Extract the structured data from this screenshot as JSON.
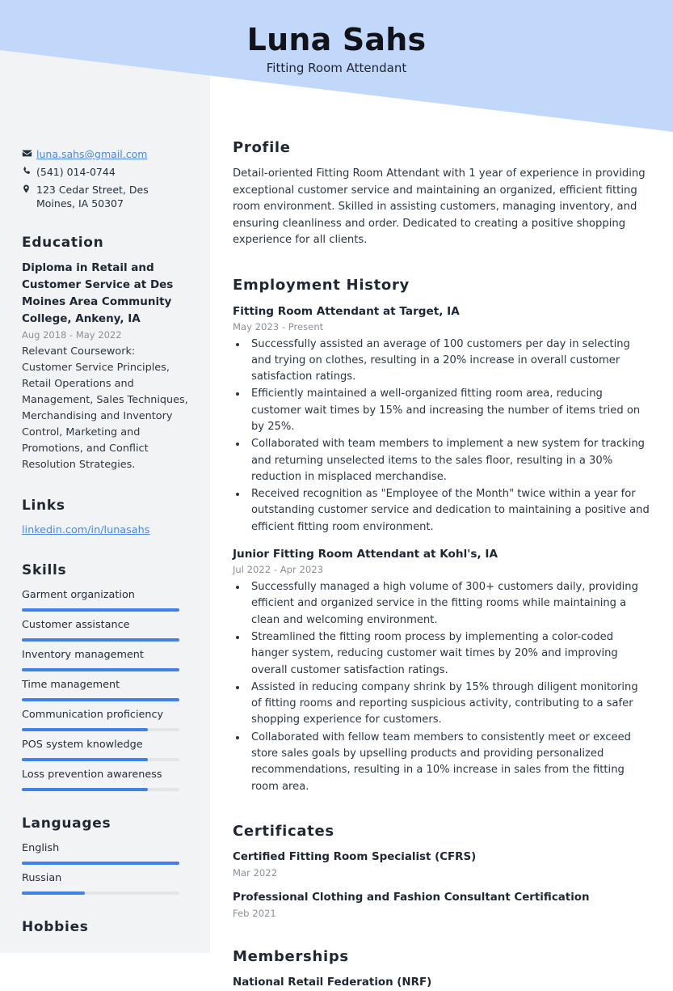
{
  "header": {
    "name": "Luna Sahs",
    "job_title": "Fitting Room Attendant",
    "banner_color": "#c2d8fb"
  },
  "theme": {
    "accent": "#4180e8",
    "sidebar_bg": "#f2f3f4",
    "link_color": "#4a87e8",
    "heading_color": "#1f2733",
    "muted_text": "#8a9099"
  },
  "sidebar": {
    "contact": [
      {
        "icon": "envelope-icon",
        "value": "luna.sahs@gmail.com",
        "is_link": true
      },
      {
        "icon": "phone-icon",
        "value": "(541) 014-0744",
        "is_link": false
      },
      {
        "icon": "location-pin-icon",
        "value": "123 Cedar Street, Des Moines, IA 50307",
        "is_link": false
      }
    ],
    "education": {
      "heading": "Education",
      "entries": [
        {
          "title": "Diploma in Retail and Customer Service at Des Moines Area Community College, Ankeny, IA",
          "date": "Aug 2018 - May 2022",
          "description": "Relevant Coursework: Customer Service Principles, Retail Operations and Management, Sales Techniques, Merchandising and Inventory Control, Marketing and Promotions, and Conflict Resolution Strategies."
        }
      ]
    },
    "links": {
      "heading": "Links",
      "items": [
        {
          "label": "linkedin.com/in/lunasahs"
        }
      ]
    },
    "skills": {
      "heading": "Skills",
      "items": [
        {
          "label": "Garment organization",
          "level": 100
        },
        {
          "label": "Customer assistance",
          "level": 100
        },
        {
          "label": "Inventory management",
          "level": 100
        },
        {
          "label": "Time management",
          "level": 100
        },
        {
          "label": "Communication proficiency",
          "level": 80
        },
        {
          "label": "POS system knowledge",
          "level": 80
        },
        {
          "label": "Loss prevention awareness",
          "level": 80
        }
      ]
    },
    "languages": {
      "heading": "Languages",
      "items": [
        {
          "label": "English",
          "level": 100
        },
        {
          "label": "Russian",
          "level": 40
        }
      ]
    },
    "hobbies": {
      "heading": "Hobbies"
    }
  },
  "main": {
    "profile": {
      "heading": "Profile",
      "text": "Detail-oriented Fitting Room Attendant with 1 year of experience in providing exceptional customer service and maintaining an organized, efficient fitting room environment. Skilled in assisting customers, managing inventory, and ensuring cleanliness and order. Dedicated to creating a positive shopping experience for all clients."
    },
    "employment": {
      "heading": "Employment History",
      "jobs": [
        {
          "title": "Fitting Room Attendant at Target, IA",
          "date": "May 2023 - Present",
          "bullets": [
            "Successfully assisted an average of 100 customers per day in selecting and trying on clothes, resulting in a 20% increase in overall customer satisfaction ratings.",
            "Efficiently maintained a well-organized fitting room area, reducing customer wait times by 15% and increasing the number of items tried on by 25%.",
            "Collaborated with team members to implement a new system for tracking and returning unselected items to the sales floor, resulting in a 30% reduction in misplaced merchandise.",
            "Received recognition as \"Employee of the Month\" twice within a year for outstanding customer service and dedication to maintaining a positive and efficient fitting room environment."
          ]
        },
        {
          "title": "Junior Fitting Room Attendant at Kohl's, IA",
          "date": "Jul 2022 - Apr 2023",
          "bullets": [
            "Successfully managed a high volume of 300+ customers daily, providing efficient and organized service in the fitting rooms while maintaining a clean and welcoming environment.",
            "Streamlined the fitting room process by implementing a color-coded hanger system, reducing customer wait times by 20% and improving overall customer satisfaction ratings.",
            "Assisted in reducing company shrink by 15% through diligent monitoring of fitting rooms and reporting suspicious activity, contributing to a safer shopping experience for customers.",
            "Collaborated with fellow team members to consistently meet or exceed store sales goals by upselling products and providing personalized recommendations, resulting in a 10% increase in sales from the fitting room area."
          ]
        }
      ]
    },
    "certificates": {
      "heading": "Certificates",
      "items": [
        {
          "name": "Certified Fitting Room Specialist (CFRS)",
          "date": "Mar 2022"
        },
        {
          "name": "Professional Clothing and Fashion Consultant Certification",
          "date": "Feb 2021"
        }
      ]
    },
    "memberships": {
      "heading": "Memberships",
      "items": [
        {
          "name": "National Retail Federation (NRF)"
        }
      ]
    }
  }
}
